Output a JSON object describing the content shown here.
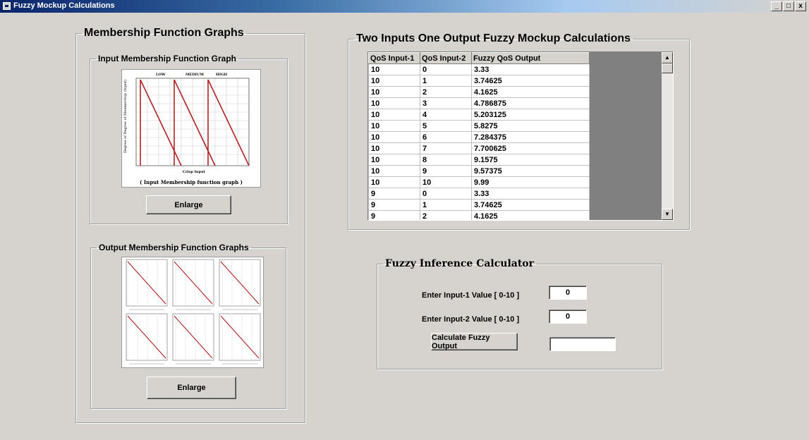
{
  "window": {
    "title": "Fuzzy Mockup Calculations",
    "buttons": [
      "_",
      "□",
      "x"
    ]
  },
  "membership": {
    "legend": "Membership Function Graphs",
    "input_group": {
      "legend": "Input Membership Function Graph",
      "graph_top_labels": [
        "LOW",
        "MEDIUM",
        "HIGH"
      ],
      "graph_xlabel": "Crisp Input",
      "graph_ylabel": "Degree of Degree of Membership (Input)",
      "caption": "( Input Membership function graph )",
      "enlarge_label": "Enlarge"
    },
    "output_group": {
      "legend": "Output Membership Function Graphs",
      "enlarge_label": "Enlarge"
    }
  },
  "table_group": {
    "legend": "Two Inputs One Output Fuzzy Mockup Calculations",
    "columns": [
      "QoS Input-1",
      "QoS Input-2",
      "Fuzzy QoS Output"
    ],
    "rows": [
      [
        "10",
        "0",
        "3.33"
      ],
      [
        "10",
        "1",
        "3.74625"
      ],
      [
        "10",
        "2",
        "4.1625"
      ],
      [
        "10",
        "3",
        "4.786875"
      ],
      [
        "10",
        "4",
        "5.203125"
      ],
      [
        "10",
        "5",
        "5.8275"
      ],
      [
        "10",
        "6",
        "7.284375"
      ],
      [
        "10",
        "7",
        "7.700625"
      ],
      [
        "10",
        "8",
        "9.1575"
      ],
      [
        "10",
        "9",
        "9.57375"
      ],
      [
        "10",
        "10",
        "9.99"
      ],
      [
        "9",
        "0",
        "3.33"
      ],
      [
        "9",
        "1",
        "3.74625"
      ],
      [
        "9",
        "2",
        "4.1625"
      ]
    ]
  },
  "calculator": {
    "legend": "Fuzzy Inference Calculator",
    "input1_label": "Enter Input-1 Value [ 0-10 ]",
    "input1_value": "0",
    "input2_label": "Enter Input-2 Value [ 0-10 ]",
    "input2_value": "0",
    "calculate_label": "Calculate Fuzzy Output",
    "output_value": ""
  },
  "colors": {
    "graph_line": "#b22222",
    "window_bg": "#d6d3ce",
    "titlebar": "#0a246a"
  }
}
